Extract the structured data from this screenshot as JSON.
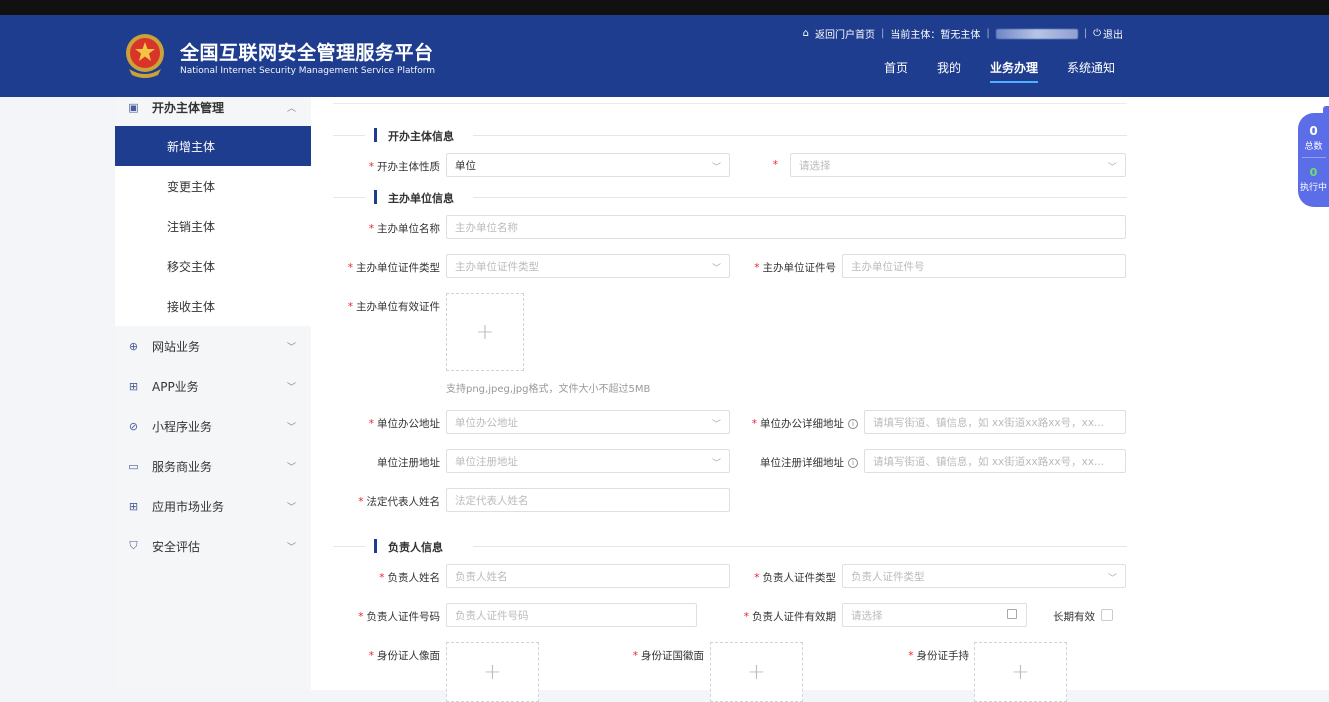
{
  "header": {
    "title_cn": "全国互联网安全管理服务平台",
    "title_en": "National Internet Security Management Service Platform",
    "utility": {
      "home_link": "返回门户首页",
      "current_entity_label": "当前主体：",
      "current_entity_value": "暂无主体",
      "logout": "退出"
    },
    "nav": [
      {
        "label": "首页"
      },
      {
        "label": "我的"
      },
      {
        "label": "业务办理"
      },
      {
        "label": "系统通知"
      }
    ],
    "active_nav": "业务办理",
    "brand_color": "#1e3d8f",
    "accent_color": "#4fb0ff"
  },
  "sidebar": {
    "group": {
      "label": "开办主体管理",
      "icon": "briefcase-icon",
      "expanded": true
    },
    "sub_items": [
      {
        "label": "新增主体",
        "active": true
      },
      {
        "label": "变更主体"
      },
      {
        "label": "注销主体"
      },
      {
        "label": "移交主体"
      },
      {
        "label": "接收主体"
      }
    ],
    "items": [
      {
        "label": "网站业务",
        "icon": "globe-icon"
      },
      {
        "label": "APP业务",
        "icon": "grid-icon"
      },
      {
        "label": "小程序业务",
        "icon": "compass-icon"
      },
      {
        "label": "服务商业务",
        "icon": "monitor-icon"
      },
      {
        "label": "应用市场业务",
        "icon": "grid-icon"
      },
      {
        "label": "安全评估",
        "icon": "shield-icon"
      }
    ]
  },
  "form": {
    "sections": {
      "entity_info": "开办主体信息",
      "sponsor_info": "主办单位信息",
      "manager_info": "负责人信息"
    },
    "entity_nature": {
      "label": "开办主体性质",
      "value": "单位"
    },
    "entity_secondary": {
      "label": "",
      "placeholder": "请选择"
    },
    "sponsor_name": {
      "label": "主办单位名称",
      "placeholder": "主办单位名称"
    },
    "sponsor_cert_type": {
      "label": "主办单位证件类型",
      "placeholder": "主办单位证件类型"
    },
    "sponsor_cert_no": {
      "label": "主办单位证件号",
      "placeholder": "主办单位证件号"
    },
    "sponsor_cert_file": {
      "label": "主办单位有效证件",
      "hint": "支持png,jpeg,jpg格式，文件大小不超过5MB"
    },
    "office_address": {
      "label": "单位办公地址",
      "placeholder": "单位办公地址"
    },
    "office_detail": {
      "label": "单位办公详细地址",
      "placeholder": "请填写街道、镇信息，如 xx街道xx路xx号，xx..."
    },
    "reg_address": {
      "label": "单位注册地址",
      "placeholder": "单位注册地址"
    },
    "reg_detail": {
      "label": "单位注册详细地址",
      "placeholder": "请填写街道、镇信息，如 xx街道xx路xx号，xx..."
    },
    "legal_rep": {
      "label": "法定代表人姓名",
      "placeholder": "法定代表人姓名"
    },
    "manager_name": {
      "label": "负责人姓名",
      "placeholder": "负责人姓名"
    },
    "manager_cert_type": {
      "label": "负责人证件类型",
      "placeholder": "负责人证件类型"
    },
    "manager_cert_no": {
      "label": "负责人证件号码",
      "placeholder": "负责人证件号码"
    },
    "manager_cert_validity": {
      "label": "负责人证件有效期",
      "placeholder": "请选择"
    },
    "long_term": {
      "label": "长期有效"
    },
    "id_portrait": {
      "label": "身份证人像面"
    },
    "id_emblem": {
      "label": "身份证国徽面"
    },
    "id_handheld": {
      "label": "身份证手持"
    }
  },
  "float_panel": {
    "total_count": "0",
    "total_label": "总数",
    "running_count": "0",
    "running_label": "执行中",
    "color": "#5b6ee8"
  }
}
